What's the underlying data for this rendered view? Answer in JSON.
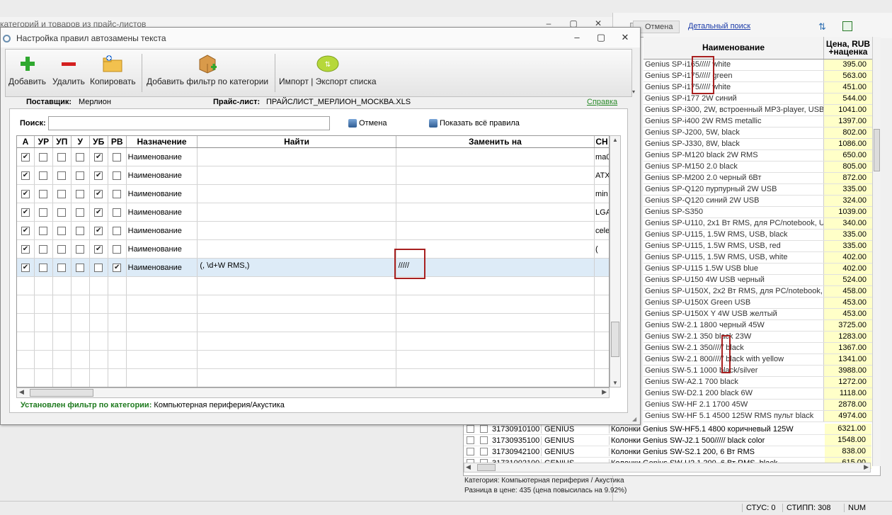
{
  "background_window": {
    "title": "категорий и товаров из прайс-листов"
  },
  "price_window": {
    "cancel_label": "Отмена",
    "detailed_search_label": "Детальный поиск",
    "columns": {
      "name": "Наименование",
      "price": "Цена, RUB +наценка"
    },
    "rows": [
      {
        "name": "Genius SP-i165///// white",
        "price": "395.00"
      },
      {
        "name": "Genius SP-i175///// green",
        "price": "563.00"
      },
      {
        "name": "Genius SP-i175///// white",
        "price": "451.00"
      },
      {
        "name": "Genius SP-i177 2W синий",
        "price": "544.00"
      },
      {
        "name": "Genius SP-i300, 2W, встроенный MP3-player, USB",
        "price": "1041.00"
      },
      {
        "name": "Genius SP-i400 2W RMS metallic",
        "price": "1397.00"
      },
      {
        "name": "Genius SP-J200, 5W, black",
        "price": "802.00"
      },
      {
        "name": "Genius SP-J330, 8W, black",
        "price": "1086.00"
      },
      {
        "name": "Genius SP-M120 black 2W RMS",
        "price": "650.00"
      },
      {
        "name": "Genius SP-M150 2.0 black",
        "price": "805.00"
      },
      {
        "name": "Genius SP-M200 2.0 черный 6Вт",
        "price": "872.00"
      },
      {
        "name": "Genius SP-Q120  пурпурный 2W USB",
        "price": "335.00"
      },
      {
        "name": "Genius SP-Q120  синий 2W USB",
        "price": "324.00"
      },
      {
        "name": "Genius SP-S350",
        "price": "1039.00"
      },
      {
        "name": "Genius SP-U110, 2x1 Вт RMS, для PC/notebook, USB",
        "price": "340.00"
      },
      {
        "name": "Genius SP-U115, 1.5W RMS, USB, black",
        "price": "335.00"
      },
      {
        "name": "Genius SP-U115, 1.5W RMS, USB, red",
        "price": "335.00"
      },
      {
        "name": "Genius SP-U115, 1.5W RMS, USB, white",
        "price": "402.00"
      },
      {
        "name": "Genius SP-U115 1.5W USB blue",
        "price": "402.00"
      },
      {
        "name": "Genius SP-U150 4W USB черный",
        "price": "524.00"
      },
      {
        "name": "Genius SP-U150X, 2x2 Вт RMS, для PC/notebook, USB",
        "price": "458.00"
      },
      {
        "name": "Genius SP-U150X Green USB",
        "price": "453.00"
      },
      {
        "name": "Genius SP-U150X Y 4W USB желтый",
        "price": "453.00"
      },
      {
        "name": "Genius SW-2.1 1800  черный 45W",
        "price": "3725.00"
      },
      {
        "name": "Genius SW-2.1 350  black 23W",
        "price": "1283.00"
      },
      {
        "name": "Genius SW-2.1 350///// black",
        "price": "1367.00"
      },
      {
        "name": " Genius SW-2.1 800///// black with yellow",
        "price": "1341.00"
      },
      {
        "name": "Genius SW-5.1 1000 black/silver",
        "price": "3988.00"
      },
      {
        "name": "Genius SW-A2.1 700  black",
        "price": "1272.00"
      },
      {
        "name": "Genius SW-D2.1 200  black 6W",
        "price": "1118.00"
      },
      {
        "name": "Genius SW-HF 2.1 1700  45W",
        "price": "2878.00"
      },
      {
        "name": "Genius SW-HF 5.1 4500 125W RMS пульт black",
        "price": "4974.00"
      }
    ],
    "lower_rows": [
      {
        "code": "31730910100",
        "brand": "GENIUS",
        "name": "Колонки Genius SW-HF5.1 4800  коричневый 125W",
        "price": "6321.00"
      },
      {
        "code": "31730935100",
        "brand": "GENIUS",
        "name": "Колонки Genius SW-J2.1 500///// black color",
        "price": "1548.00"
      },
      {
        "code": "31730942100",
        "brand": "GENIUS",
        "name": "Колонки Genius SW-S2.1 200, 6 Вт RMS",
        "price": "838.00"
      },
      {
        "code": "31731002100",
        "brand": "GENIUS",
        "name": "Колонки Genius SW-U2.1 200, 6 Вт RMS, black",
        "price": "615.00"
      }
    ],
    "category_line": "Категория: Компьютерная периферия / Акустика",
    "price_diff_line": "Разница в цене: 435  (цена повысилась на 9.92%)"
  },
  "dialog": {
    "title": "Настройка правил автозамены текста",
    "toolbar": {
      "add": "Добавить",
      "delete": "Удалить",
      "copy": "Копировать",
      "add_filter": "Добавить фильтр по категории",
      "import_export": "Импорт | Экспорт списка"
    },
    "supplier_label": "Поставщик:",
    "supplier_value": "Мерлион",
    "pricelist_label": "Прайс-лист:",
    "pricelist_value": "ПРАЙСЛИСТ_МЕРЛИОН_МОСКВА.XLS",
    "help_link": "Справка",
    "search_label": "Поиск:",
    "search_value": "",
    "cancel_button": "Отмена",
    "show_all_button": "Показать всё правила",
    "columns": {
      "a": "А",
      "ur": "УР",
      "up": "УП",
      "u": "У",
      "ub": "УБ",
      "rv": "РВ",
      "purpose": "Назначение",
      "find": "Найти",
      "replace": "Заменить на",
      "ch": "СН"
    },
    "rows": [
      {
        "a": true,
        "ur": false,
        "up": false,
        "u": false,
        "ub": true,
        "rv": false,
        "purpose": "Наименование",
        "find": "",
        "replace": "",
        "ch": "ma0"
      },
      {
        "a": true,
        "ur": false,
        "up": false,
        "u": false,
        "ub": true,
        "rv": false,
        "purpose": "Наименование",
        "find": "",
        "replace": "",
        "ch": "ATX"
      },
      {
        "a": true,
        "ur": false,
        "up": false,
        "u": false,
        "ub": true,
        "rv": false,
        "purpose": "Наименование",
        "find": "",
        "replace": "",
        "ch": "min"
      },
      {
        "a": true,
        "ur": false,
        "up": false,
        "u": false,
        "ub": true,
        "rv": false,
        "purpose": "Наименование",
        "find": "",
        "replace": "",
        "ch": "LGA"
      },
      {
        "a": true,
        "ur": false,
        "up": false,
        "u": false,
        "ub": true,
        "rv": false,
        "purpose": "Наименование",
        "find": "",
        "replace": "",
        "ch": "cele"
      },
      {
        "a": true,
        "ur": false,
        "up": false,
        "u": false,
        "ub": true,
        "rv": false,
        "purpose": "Наименование",
        "find": "",
        "replace": "",
        "ch": "("
      },
      {
        "a": true,
        "ur": false,
        "up": false,
        "u": false,
        "ub": false,
        "rv": true,
        "purpose": "Наименование",
        "find": "(, \\d+W RMS,)",
        "replace": "/////",
        "ch": ""
      }
    ],
    "filter_label": "Установлен фильтр по категории:",
    "filter_value": "Компьютерная периферия/Акустика"
  },
  "statusbar": {
    "stus": "СТУС: 0",
    "stipp": "СТИПП: 308",
    "num": "NUM"
  },
  "colors": {
    "price_cell": "#ffffc8",
    "selected_row": "#ddebf7",
    "highlight_box": "#a82020",
    "link": "#2a8a2a"
  }
}
